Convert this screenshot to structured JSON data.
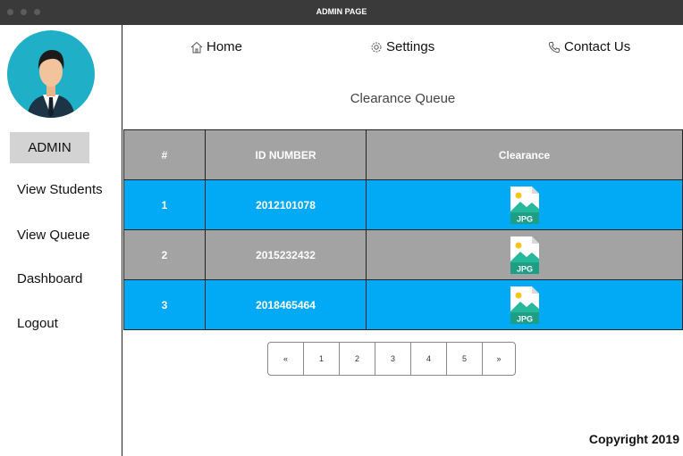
{
  "window": {
    "title": "ADMIN PAGE"
  },
  "sidebar": {
    "role_label": "ADMIN",
    "items": [
      {
        "label": "View Students"
      },
      {
        "label": "View Queue"
      },
      {
        "label": "Dashboard"
      },
      {
        "label": "Logout"
      }
    ]
  },
  "nav": {
    "home": "Home",
    "settings": "Settings",
    "contact": "Contact Us"
  },
  "main": {
    "title": "Clearance Queue",
    "table": {
      "headers": [
        "#",
        "ID NUMBER",
        "Clearance"
      ],
      "rows": [
        {
          "num": "1",
          "id": "2012101078",
          "file_label": "JPG"
        },
        {
          "num": "2",
          "id": "2015232432",
          "file_label": "JPG"
        },
        {
          "num": "3",
          "id": "2018465464",
          "file_label": "JPG"
        }
      ]
    },
    "pagination": [
      "«",
      "1",
      "2",
      "3",
      "4",
      "5",
      "»"
    ]
  },
  "footer": {
    "copyright": "Copyright  2019"
  },
  "colors": {
    "titlebar": "#3a3a3a",
    "row_blue": "#02a9f4",
    "row_gray": "#a3a3a3",
    "avatar_bg": "#1fb0c8"
  },
  "icons": [
    "home-icon",
    "gear-icon",
    "phone-icon",
    "jpg-file-icon",
    "avatar-icon"
  ]
}
